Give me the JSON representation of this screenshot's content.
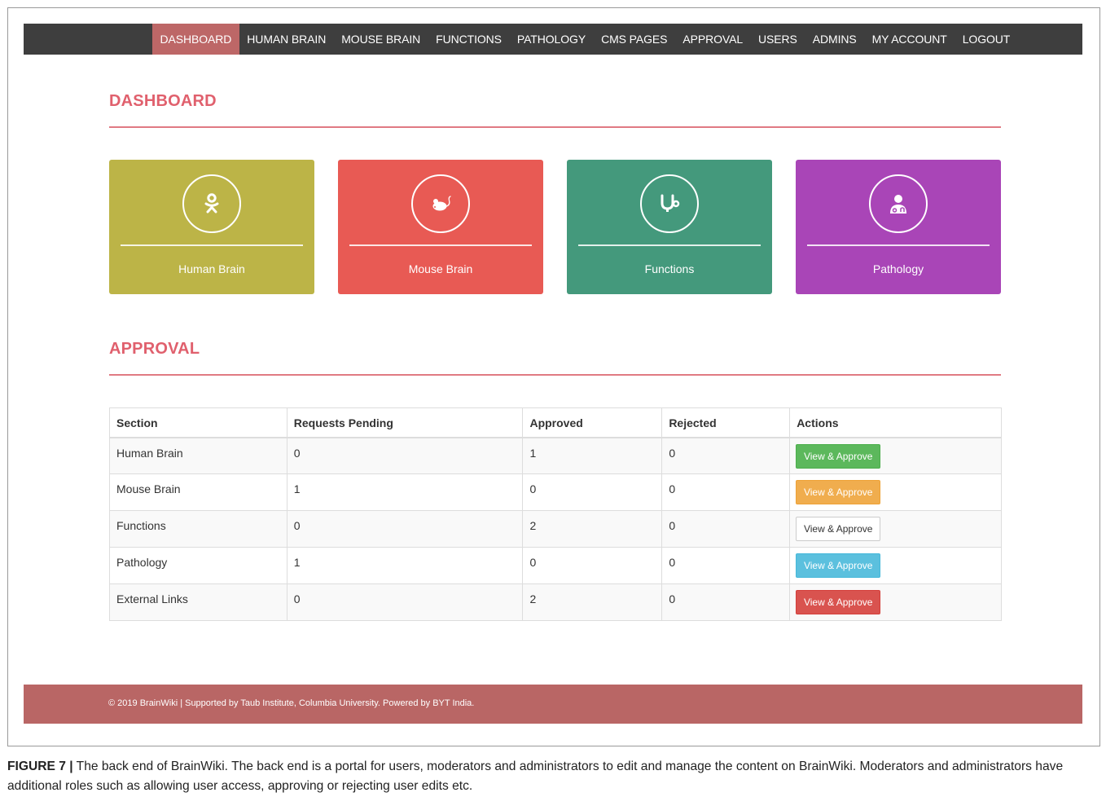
{
  "nav": {
    "items": [
      {
        "label": "DASHBOARD",
        "active": true
      },
      {
        "label": "HUMAN BRAIN"
      },
      {
        "label": "MOUSE BRAIN"
      },
      {
        "label": "FUNCTIONS"
      },
      {
        "label": "PATHOLOGY"
      },
      {
        "label": "CMS PAGES"
      },
      {
        "label": "APPROVAL"
      },
      {
        "label": "USERS"
      },
      {
        "label": "ADMINS"
      },
      {
        "label": "MY ACCOUNT"
      },
      {
        "label": "LOGOUT"
      }
    ]
  },
  "dashboard": {
    "title": "DASHBOARD",
    "cards": [
      {
        "label": "Human Brain",
        "icon": "odnoklassniki-icon",
        "color": "#bcb447"
      },
      {
        "label": "Mouse Brain",
        "icon": "mouse-icon",
        "color": "#e85a54"
      },
      {
        "label": "Functions",
        "icon": "stethoscope-icon",
        "color": "#44997c"
      },
      {
        "label": "Pathology",
        "icon": "doctor-icon",
        "color": "#a945b7"
      }
    ]
  },
  "approval": {
    "title": "APPROVAL",
    "headers": [
      "Section",
      "Requests Pending",
      "Approved",
      "Rejected",
      "Actions"
    ],
    "rows": [
      {
        "section": "Human Brain",
        "pending": "0",
        "approved": "1",
        "rejected": "0",
        "action": "View & Approve",
        "button_color": "#5cb85c"
      },
      {
        "section": "Mouse Brain",
        "pending": "1",
        "approved": "0",
        "rejected": "0",
        "action": "View & Approve",
        "button_color": "#f0ad4e"
      },
      {
        "section": "Functions",
        "pending": "0",
        "approved": "2",
        "rejected": "0",
        "action": "View & Approve",
        "button_color": "#ffffff"
      },
      {
        "section": "Pathology",
        "pending": "1",
        "approved": "0",
        "rejected": "0",
        "action": "View & Approve",
        "button_color": "#5bc0de"
      },
      {
        "section": "External Links",
        "pending": "0",
        "approved": "2",
        "rejected": "0",
        "action": "View & Approve",
        "button_color": "#d9534f"
      }
    ]
  },
  "footer": {
    "text": "© 2019 BrainWiki | Supported by Taub Institute, Columbia University. Powered by BYT India."
  },
  "caption": {
    "label": "FIGURE 7 |",
    "text": " The back end of BrainWiki. The back end is a portal for users, moderators and administrators to edit and manage the content on BrainWiki. Moderators and administrators have additional roles such as allowing user access, approving or rejecting user edits etc."
  },
  "colors": {
    "nav_bg": "#3e3e3e",
    "nav_active": "#bd6767",
    "section_title": "#e0606d",
    "footer_bg": "#b96665"
  }
}
